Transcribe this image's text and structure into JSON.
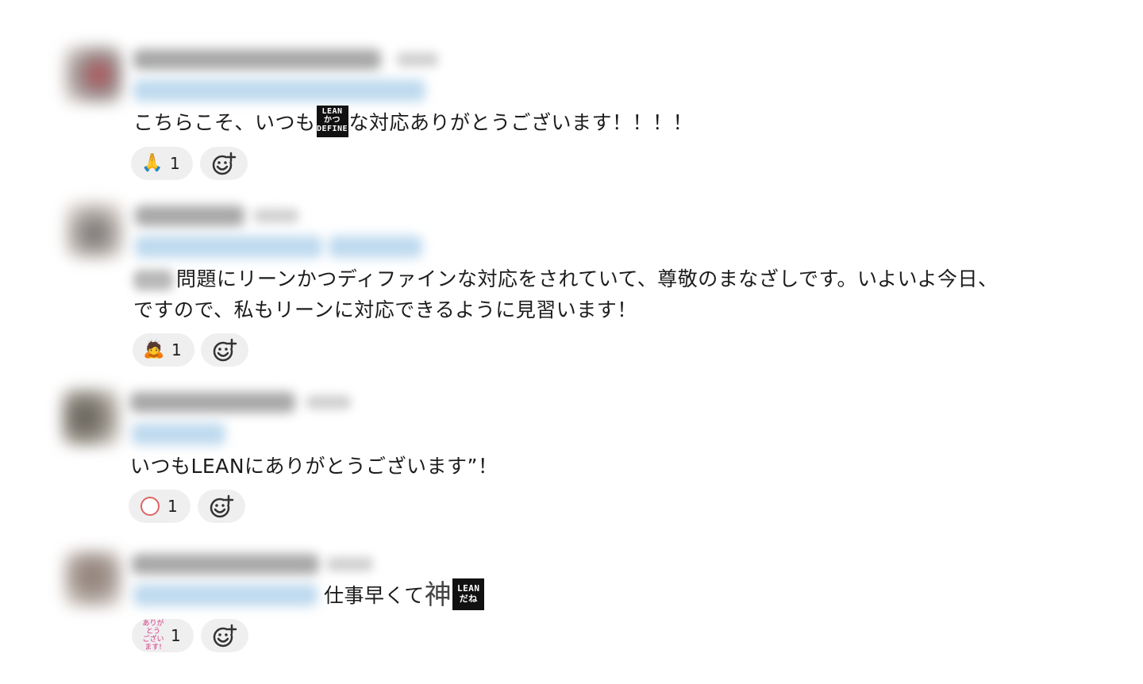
{
  "messages": [
    {
      "body": "こちらこそ、いつも",
      "body_after_emoji": "な対応ありがとうございます！！！！",
      "inline_emoji": "LEAN\nかつ\nDEFINE",
      "reaction": {
        "emoji": "🙏",
        "count": "1"
      }
    },
    {
      "body_line1": "問題にリーンかつディファインな対応をされていて、尊敬のまなざしです。いよいよ今日、",
      "body_line2": "ですので、私もリーンに対応できるように見習います！",
      "reaction": {
        "emoji": "🙇",
        "count": "1"
      }
    },
    {
      "body": "いつもLEANにありがとうございます”！",
      "reaction": {
        "emoji": "circle",
        "count": "1"
      }
    },
    {
      "body": "仕事早くて",
      "kanji": "神",
      "inline_emoji": "LEAN\nだね",
      "reaction": {
        "emoji": "ありがとう\nございます!",
        "count": "1"
      }
    }
  ]
}
